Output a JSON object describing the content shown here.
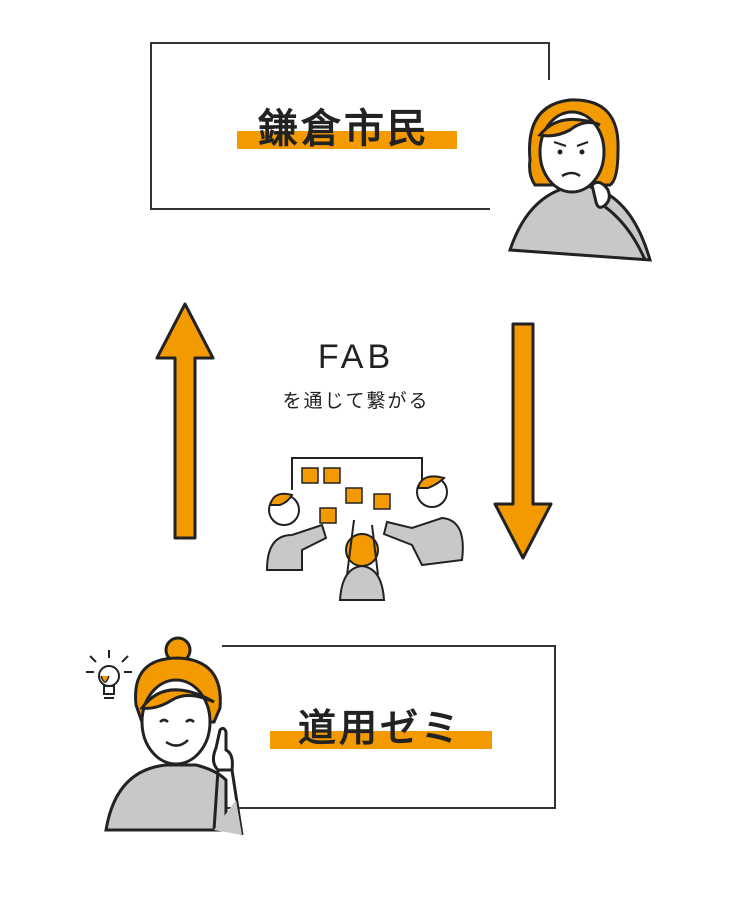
{
  "top_box": {
    "label": "鎌倉市民"
  },
  "bottom_box": {
    "label": "道用ゼミ"
  },
  "center": {
    "title": "FAB",
    "subtitle": "を通じて繋がる"
  },
  "colors": {
    "accent": "#F29A00",
    "line": "#222222",
    "gray": "#C8C8C8"
  },
  "icons": [
    "thinking-woman-icon",
    "idea-woman-icon",
    "lightbulb-icon",
    "workshop-group-icon",
    "up-arrow",
    "down-arrow"
  ]
}
